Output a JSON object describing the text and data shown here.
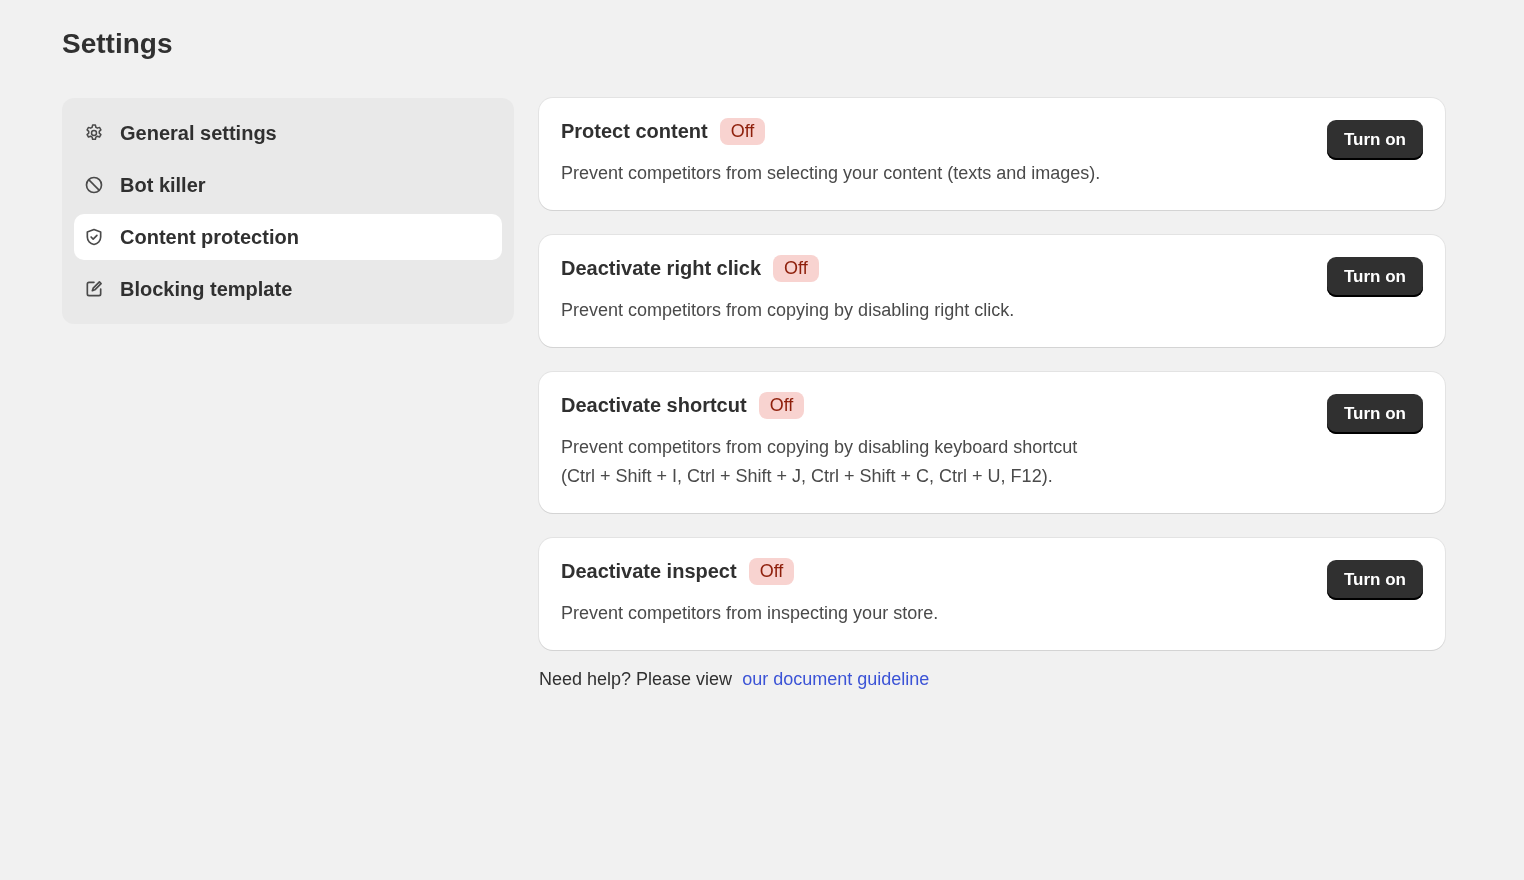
{
  "page": {
    "title": "Settings"
  },
  "sidebar": {
    "items": [
      {
        "label": "General settings",
        "kind": "gear",
        "selected": false
      },
      {
        "label": "Bot killer",
        "kind": "ban",
        "selected": false
      },
      {
        "label": "Content protection",
        "kind": "shield",
        "selected": true
      },
      {
        "label": "Blocking template",
        "kind": "edit",
        "selected": false
      }
    ]
  },
  "cards": [
    {
      "title": "Protect content",
      "status": "Off",
      "on": false,
      "description": [
        "Prevent competitors from selecting your content (texts and images)."
      ],
      "button": "Turn on"
    },
    {
      "title": "Deactivate right click",
      "status": "Off",
      "on": false,
      "description": [
        "Prevent competitors from copying by disabling right click."
      ],
      "button": "Turn on"
    },
    {
      "title": "Deactivate shortcut",
      "status": "Off",
      "on": false,
      "description": [
        "Prevent competitors from copying by disabling keyboard shortcut",
        "(Ctrl + Shift + I, Ctrl + Shift + J, Ctrl + Shift + C, Ctrl + U, F12)."
      ],
      "button": "Turn on"
    },
    {
      "title": "Deactivate inspect",
      "status": "Off",
      "on": false,
      "description": [
        "Prevent competitors from inspecting your store."
      ],
      "button": "Turn on"
    }
  ],
  "help": {
    "text": "Need help? Please view",
    "link": "our document guideline"
  }
}
